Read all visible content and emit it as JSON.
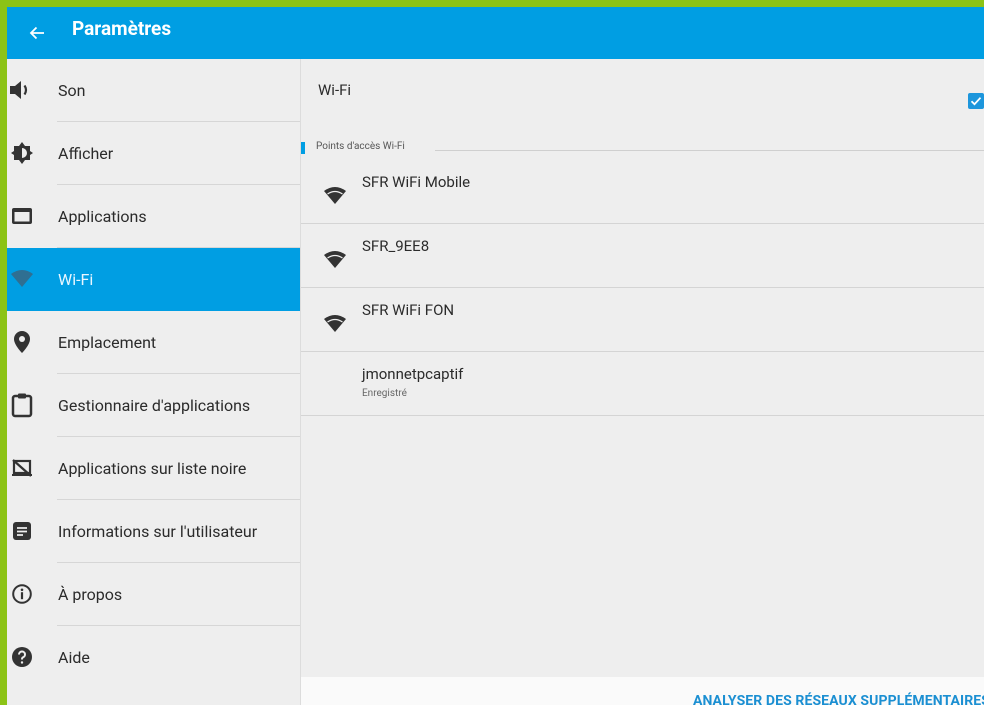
{
  "header": {
    "title": "Paramètres"
  },
  "sidebar": {
    "items": [
      {
        "label": "Son",
        "icon": "volume-icon"
      },
      {
        "label": "Afficher",
        "icon": "brightness-icon"
      },
      {
        "label": "Applications",
        "icon": "window-icon"
      },
      {
        "label": "Wi-Fi",
        "icon": "wifi-icon",
        "active": true
      },
      {
        "label": "Emplacement",
        "icon": "location-icon"
      },
      {
        "label": "Gestionnaire d'applications",
        "icon": "clipboard-icon"
      },
      {
        "label": "Applications sur liste noire",
        "icon": "blocked-screen-icon"
      },
      {
        "label": "Informations sur l'utilisateur",
        "icon": "document-icon"
      },
      {
        "label": "À propos",
        "icon": "info-icon"
      },
      {
        "label": "Aide",
        "icon": "help-icon"
      }
    ]
  },
  "main": {
    "wifi_label": "Wi-Fi",
    "wifi_enabled": true,
    "section_label": "Points d'accès Wi-Fi",
    "networks": [
      {
        "name": "SFR WiFi Mobile",
        "status": ""
      },
      {
        "name": "SFR_9EE8",
        "status": ""
      },
      {
        "name": "SFR WiFi FON",
        "status": ""
      },
      {
        "name": "jmonnetpcaptif",
        "status": "Enregistré"
      }
    ],
    "scan_button": "ANALYSER DES RÉSEAUX SUPPLÉMENTAIRES"
  },
  "colors": {
    "accent": "#009ee3",
    "frame": "#8cc316",
    "background": "#eeeeee"
  }
}
